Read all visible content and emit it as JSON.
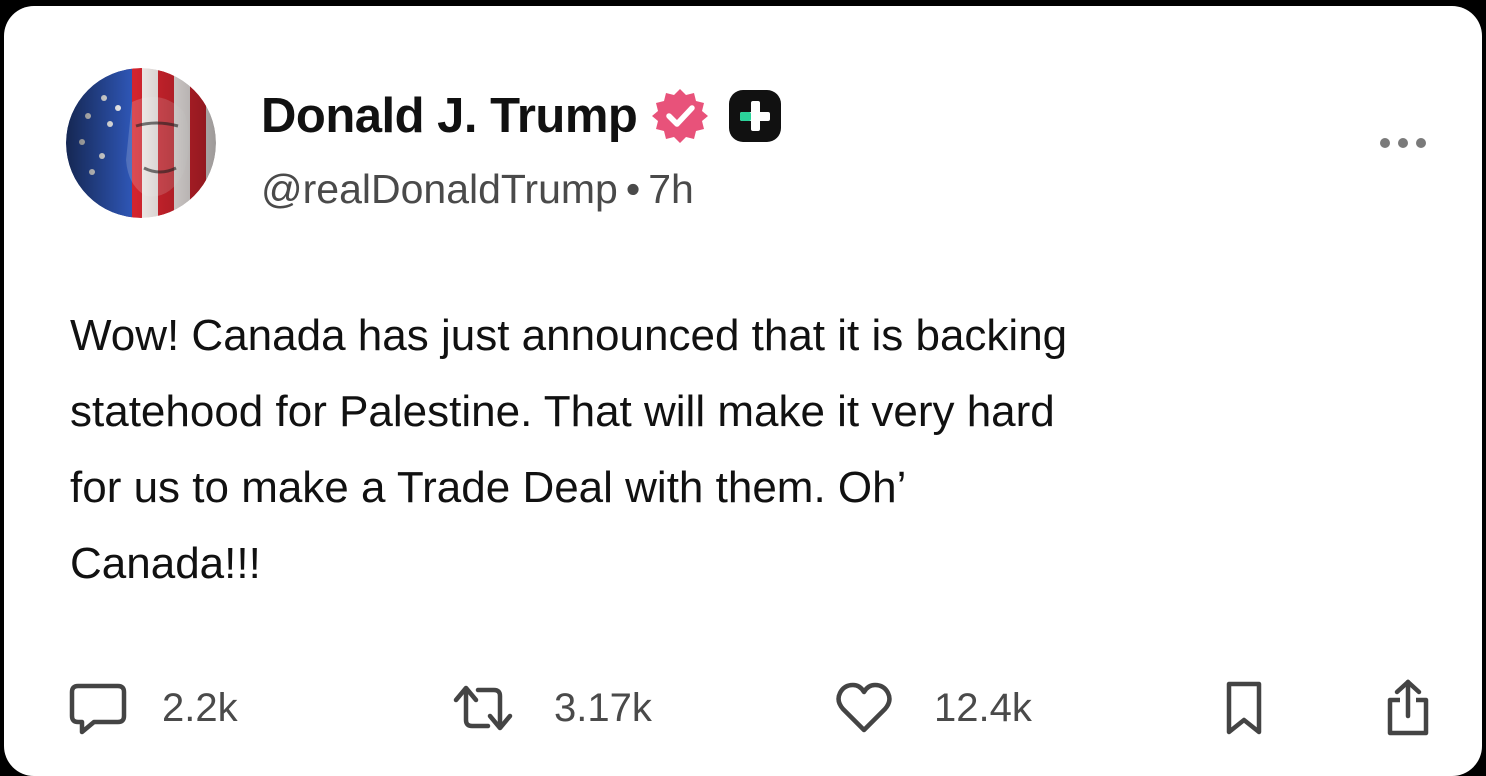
{
  "post": {
    "author_name": "Donald J. Trump",
    "handle": "@realDonaldTrump",
    "separator": "•",
    "time_ago": "7h",
    "text": "Wow! Canada has just announced that it is backing\nstatehood for Palestine. That will make it very hard\nfor us to make a Trade Deal with them. Oh’\nCanada!!!"
  },
  "icons": {
    "verified": "verified-badge-icon",
    "plus": "plus-badge-icon",
    "more": "more-options-icon",
    "reply": "reply-icon",
    "repost": "repost-icon",
    "like": "heart-icon",
    "bookmark": "bookmark-icon",
    "share": "share-icon"
  },
  "actions": {
    "replies": "2.2k",
    "reposts": "3.17k",
    "likes": "12.4k"
  },
  "colors": {
    "verified_badge": "#e8527a",
    "plus_badge": "#111111",
    "plus_mark": "#2bd39a",
    "text": "#111111",
    "muted": "#4a4a4a"
  }
}
